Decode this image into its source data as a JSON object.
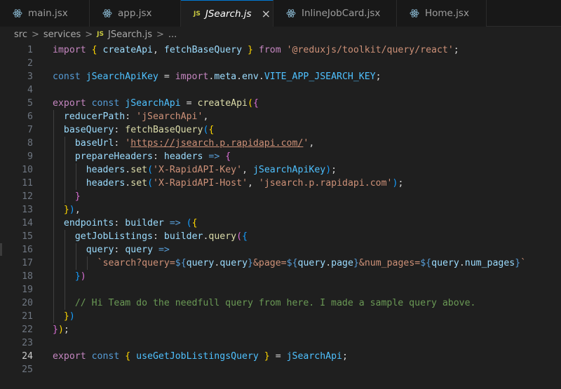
{
  "tabs": [
    {
      "label": "main.jsx",
      "icon": "react-icon",
      "active": false
    },
    {
      "label": "app.jsx",
      "icon": "react-icon",
      "active": false
    },
    {
      "label": "JSearch.js",
      "icon": "js-icon",
      "active": true
    },
    {
      "label": "InlineJobCard.jsx",
      "icon": "react-icon",
      "active": false
    },
    {
      "label": "Home.jsx",
      "icon": "react-icon",
      "active": false
    }
  ],
  "tab_js_badge": "JS",
  "tab_close_glyph": "×",
  "breadcrumb": {
    "items": [
      "src",
      "services",
      "JSearch.js",
      "..."
    ],
    "separator": ">",
    "file_badge": "JS"
  },
  "editor": {
    "current_line": 24,
    "line_numbers": [
      "1",
      "2",
      "3",
      "4",
      "5",
      "6",
      "7",
      "8",
      "9",
      "10",
      "11",
      "12",
      "13",
      "14",
      "15",
      "16",
      "17",
      "18",
      "19",
      "20",
      "21",
      "22",
      "23",
      "24",
      "25"
    ],
    "lines": [
      "import { createApi, fetchBaseQuery } from '@reduxjs/toolkit/query/react';",
      "",
      "const jSearchApiKey = import.meta.env.VITE_APP_JSEARCH_KEY;",
      "",
      "export const jSearchApi = createApi({",
      "  reducerPath: 'jSearchApi',",
      "  baseQuery: fetchBaseQuery({",
      "    baseUrl: 'https://jsearch.p.rapidapi.com/',",
      "    prepareHeaders: headers => {",
      "      headers.set('X-RapidAPI-Key', jSearchApiKey);",
      "      headers.set('X-RapidAPI-Host', 'jsearch.p.rapidapi.com');",
      "    }",
      "  }),",
      "  endpoints: builder => ({",
      "    getJobListings: builder.query({",
      "      query: query =>",
      "        `search?query=${query.query}&page=${query.page}&num_pages=${query.num_pages}`",
      "    })",
      "",
      "    // Hi Team do the needfull query from here. I made a sample query above.",
      "  })",
      "});",
      "",
      "export const { useGetJobListingsQuery } = jSearchApi;",
      ""
    ]
  },
  "colors": {
    "background": "#1f1f1f",
    "keyword": "#569cd6",
    "control": "#c586c0",
    "function": "#dcdcaa",
    "variable": "#9cdcfe",
    "string": "#ce9178",
    "comment": "#6a9955",
    "active_tab_border": "#0078d4"
  }
}
